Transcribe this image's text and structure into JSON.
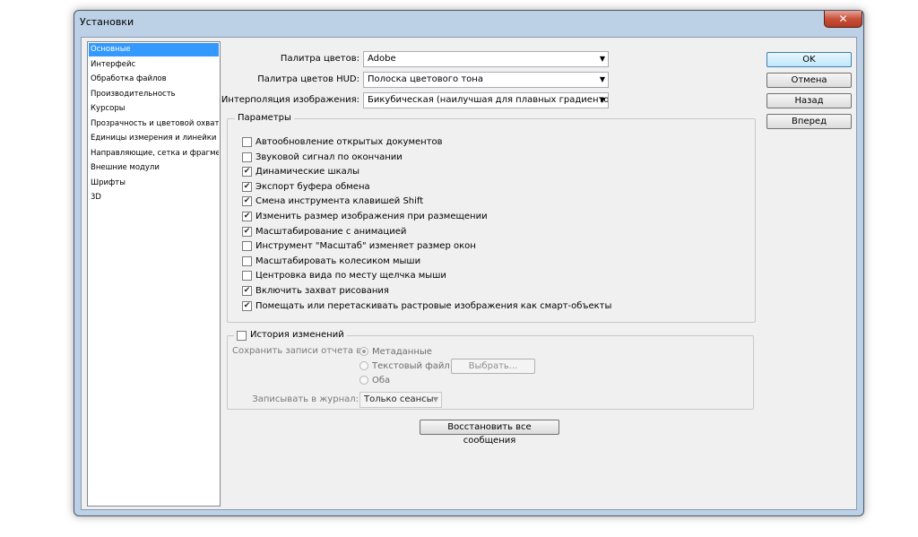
{
  "window": {
    "title": "Установки",
    "close_glyph": "✕"
  },
  "nav": {
    "items": [
      "Основные",
      "Интерфейс",
      "Обработка файлов",
      "Производительность",
      "Курсоры",
      "Прозрачность и цветовой охват",
      "Единицы измерения и линейки",
      "Направляющие, сетка и фрагменты",
      "Внешние модули",
      "Шрифты",
      "3D"
    ],
    "selected": 0
  },
  "fields": {
    "color_picker_label": "Палитра цветов:",
    "color_picker_value": "Adobe",
    "hud_picker_label": "Палитра цветов HUD:",
    "hud_picker_value": "Полоска цветового тона",
    "interp_label": "Интерполяция изображения:",
    "interp_value": "Бикубическая (наилучшая для плавных градиентов)"
  },
  "params": {
    "title": "Параметры",
    "items": [
      {
        "label": "Автообновление открытых документов",
        "checked": false
      },
      {
        "label": "Звуковой сигнал по окончании",
        "checked": false
      },
      {
        "label": "Динамические шкалы",
        "checked": true
      },
      {
        "label": "Экспорт буфера обмена",
        "checked": true
      },
      {
        "label": "Смена инструмента клавишей Shift",
        "checked": true
      },
      {
        "label": "Изменить размер изображения при размещении",
        "checked": true
      },
      {
        "label": "Масштабирование с анимацией",
        "checked": true
      },
      {
        "label": "Инструмент \"Масштаб\" изменяет размер окон",
        "checked": false
      },
      {
        "label": "Масштабировать колесиком мыши",
        "checked": false
      },
      {
        "label": "Центровка вида по месту щелчка мыши",
        "checked": false
      },
      {
        "label": "Включить захват рисования",
        "checked": true
      },
      {
        "label": "Помещать или перетаскивать растровые изображения как смарт-объекты",
        "checked": true
      }
    ]
  },
  "history": {
    "title": "История изменений",
    "checked": false,
    "save_label": "Сохранить записи отчета в:",
    "options": [
      "Метаданные",
      "Текстовый файл",
      "Оба"
    ],
    "selected": 0,
    "choose_button": "Выбрать...",
    "log_label": "Записывать в журнал:",
    "log_value": "Только сеансы"
  },
  "reset_button": "Восстановить все сообщения",
  "buttons": {
    "ok": "OK",
    "cancel": "Отмена",
    "back": "Назад",
    "forward": "Вперед"
  },
  "colors": {
    "selection": "#3399ff",
    "frame": "#bcd0e6",
    "close": "#c8513b"
  }
}
